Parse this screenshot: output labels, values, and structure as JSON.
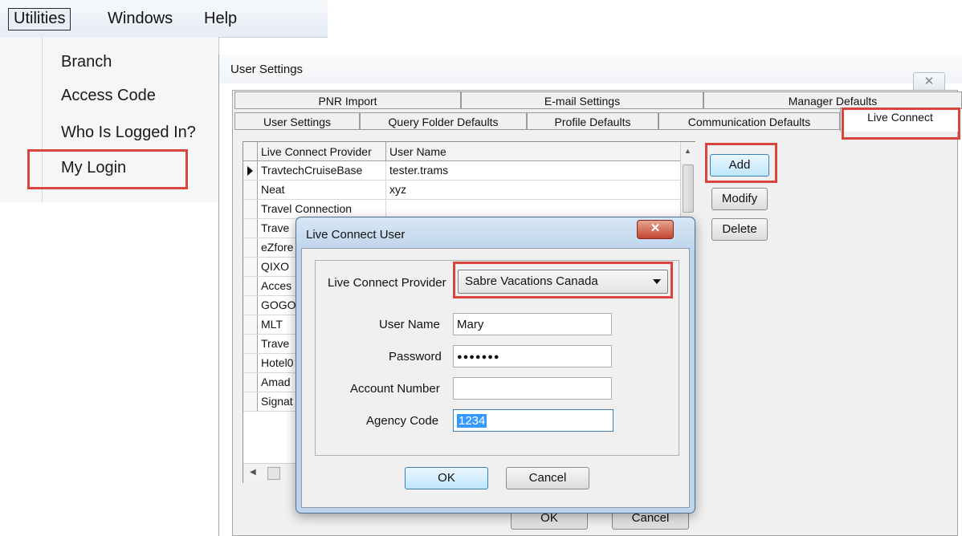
{
  "menu": {
    "bar": {
      "utilities": "Utilities",
      "windows": "Windows",
      "help": "Help"
    },
    "items": [
      "Branch",
      "Access Code",
      "Who Is Logged In?",
      "My Login"
    ]
  },
  "user_settings": {
    "title": "User Settings",
    "close_glyph": "✕",
    "tabs_row1": [
      "PNR Import",
      "E-mail Settings",
      "Manager Defaults"
    ],
    "tabs_row2": [
      "User Settings",
      "Query Folder Defaults",
      "Profile Defaults",
      "Communication Defaults",
      "Live Connect"
    ],
    "grid": {
      "columns": [
        "Live Connect Provider",
        "User Name"
      ],
      "rows": [
        {
          "provider": "TravtechCruiseBase",
          "username": "tester.trams"
        },
        {
          "provider": "Neat",
          "username": "xyz"
        },
        {
          "provider": "Travel Connection",
          "username": ""
        },
        {
          "provider": "Trave",
          "username": ""
        },
        {
          "provider": "eZfore",
          "username": ""
        },
        {
          "provider": "QIXO",
          "username": ""
        },
        {
          "provider": "Acces",
          "username": ""
        },
        {
          "provider": "GOGO",
          "username": ""
        },
        {
          "provider": "MLT",
          "username": ""
        },
        {
          "provider": "Trave",
          "username": ""
        },
        {
          "provider": "Hotel0",
          "username": ""
        },
        {
          "provider": "Amad",
          "username": ""
        },
        {
          "provider": "Signat",
          "username": ""
        }
      ]
    },
    "buttons": {
      "add": "Add",
      "modify": "Modify",
      "delete": "Delete",
      "ok": "OK",
      "cancel": "Cancel"
    }
  },
  "live_connect_dialog": {
    "title": "Live Connect User",
    "close_glyph": "✕",
    "provider_label": "Live Connect Provider",
    "provider_value": "Sabre Vacations Canada",
    "username_label": "User Name",
    "username_value": "Mary",
    "password_label": "Password",
    "password_value": "●●●●●●●",
    "account_label": "Account Number",
    "account_value": "",
    "agency_label": "Agency Code",
    "agency_value": "1234",
    "ok": "OK",
    "cancel": "Cancel"
  }
}
